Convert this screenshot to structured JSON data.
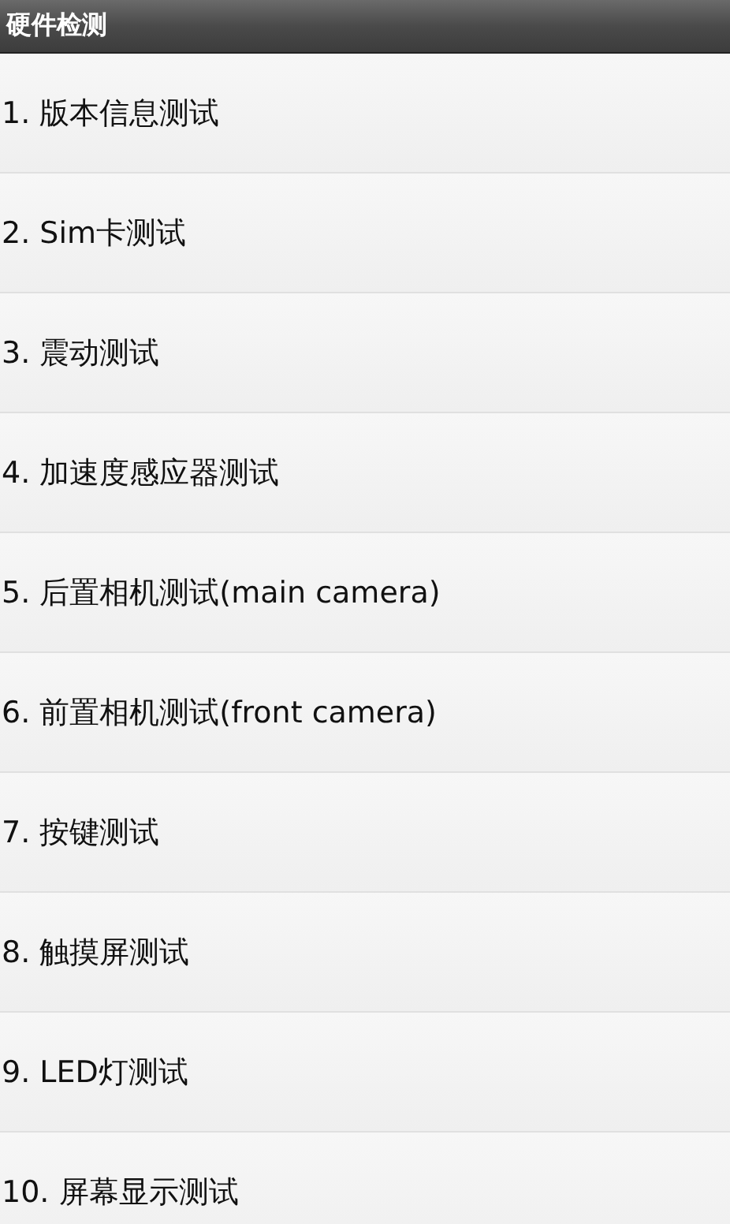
{
  "title_bar": {
    "title": "硬件检测"
  },
  "items": [
    {
      "label": "1. 版本信息测试"
    },
    {
      "label": "2. Sim卡测试"
    },
    {
      "label": "3. 震动测试"
    },
    {
      "label": "4. 加速度感应器测试"
    },
    {
      "label": "5. 后置相机测试(main camera)"
    },
    {
      "label": "6. 前置相机测试(front camera)"
    },
    {
      "label": "7. 按键测试"
    },
    {
      "label": "8. 触摸屏测试"
    },
    {
      "label": "9. LED灯测试"
    },
    {
      "label": "10. 屏幕显示测试"
    }
  ]
}
